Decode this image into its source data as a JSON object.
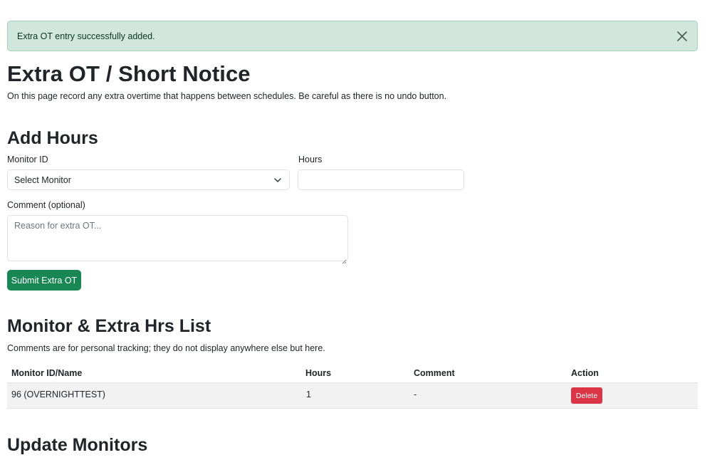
{
  "alert": {
    "message": "Extra OT entry successfully added."
  },
  "page": {
    "title": "Extra OT / Short Notice",
    "intro": "On this page record any extra overtime that happens between schedules. Be careful as there is no undo button."
  },
  "add_hours": {
    "heading": "Add Hours",
    "monitor_label": "Monitor ID",
    "monitor_selected": "Select Monitor",
    "hours_label": "Hours",
    "hours_value": "",
    "comment_label": "Comment (optional)",
    "comment_placeholder": "Reason for extra OT...",
    "submit_label": "Submit Extra OT"
  },
  "list": {
    "heading": "Monitor & Extra Hrs List",
    "note": "Comments are for personal tracking; they do not display anywhere else but here.",
    "columns": [
      "Monitor ID/Name",
      "Hours",
      "Comment",
      "Action"
    ],
    "rows": [
      {
        "monitor": "96 (OVERNIGHTTEST)",
        "hours": "1",
        "comment": "-",
        "action_label": "Delete"
      }
    ]
  },
  "update": {
    "heading": "Update Monitors"
  },
  "colors": {
    "success": "#198754",
    "danger": "#dc3545",
    "alert_bg": "#d1e7dd"
  }
}
